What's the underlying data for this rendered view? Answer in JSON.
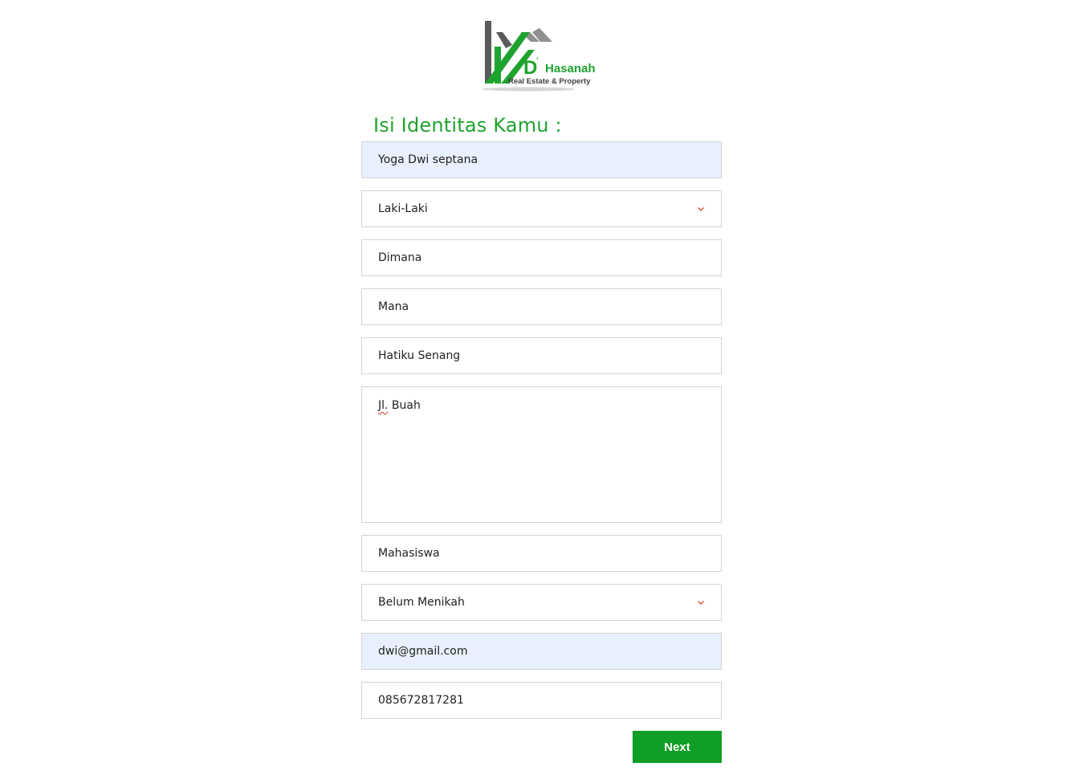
{
  "logo": {
    "brand_letter": "D",
    "brand_name": "Hasanah",
    "brand_tagline": "Real Estate & Property",
    "colors": {
      "green": "#1fa32f",
      "gray": "#5a5a5a",
      "roof": "#8f8f8f"
    }
  },
  "form": {
    "title": "Isi Identitas Kamu :",
    "name_value": "Yoga Dwi septana",
    "gender_selected": "Laki-Laki",
    "birthplace_value": "Dimana",
    "birthdate_value": "Mana",
    "religion_value": "Hatiku Senang",
    "address_word1": "Jl.",
    "address_rest": " Buah",
    "occupation_value": "Mahasiswa",
    "marital_selected": "Belum Menikah",
    "email_value": "dwi@gmail.com",
    "phone_value": "085672817281",
    "next_label": "Next"
  },
  "colors": {
    "accent": "#1fa32f",
    "button": "#109e26",
    "autofill_bg": "#e8f0fe",
    "chevron": "#e0533a"
  }
}
